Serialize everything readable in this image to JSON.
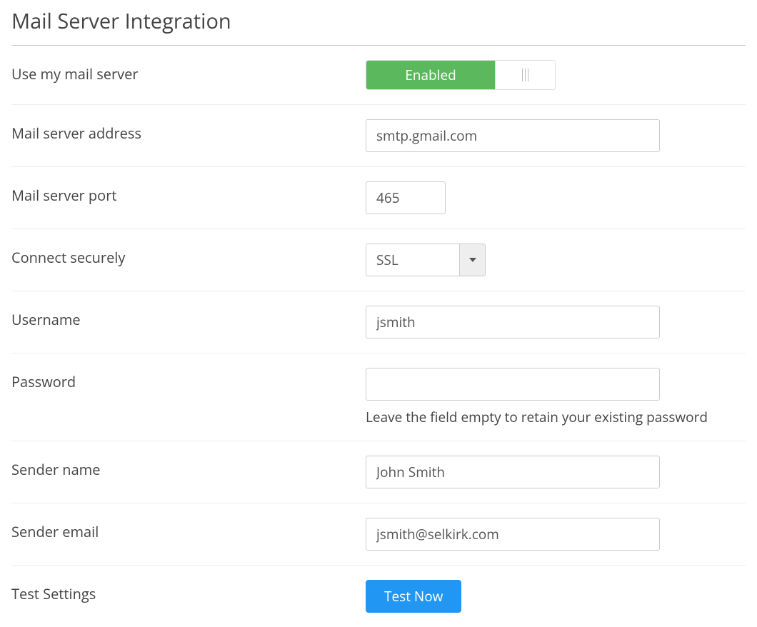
{
  "title": "Mail Server Integration",
  "toggle": {
    "label": "Use my mail server",
    "state_label": "Enabled"
  },
  "address": {
    "label": "Mail server address",
    "value": "smtp.gmail.com"
  },
  "port": {
    "label": "Mail server port",
    "value": "465"
  },
  "secure": {
    "label": "Connect securely",
    "value": "SSL"
  },
  "username": {
    "label": "Username",
    "value": "jsmith"
  },
  "password": {
    "label": "Password",
    "value": "",
    "help": "Leave the field empty to retain your existing password"
  },
  "sender_name": {
    "label": "Sender name",
    "value": "John Smith"
  },
  "sender_email": {
    "label": "Sender email",
    "value": "jsmith@selkirk.com"
  },
  "test": {
    "label": "Test Settings",
    "button": "Test Now"
  }
}
